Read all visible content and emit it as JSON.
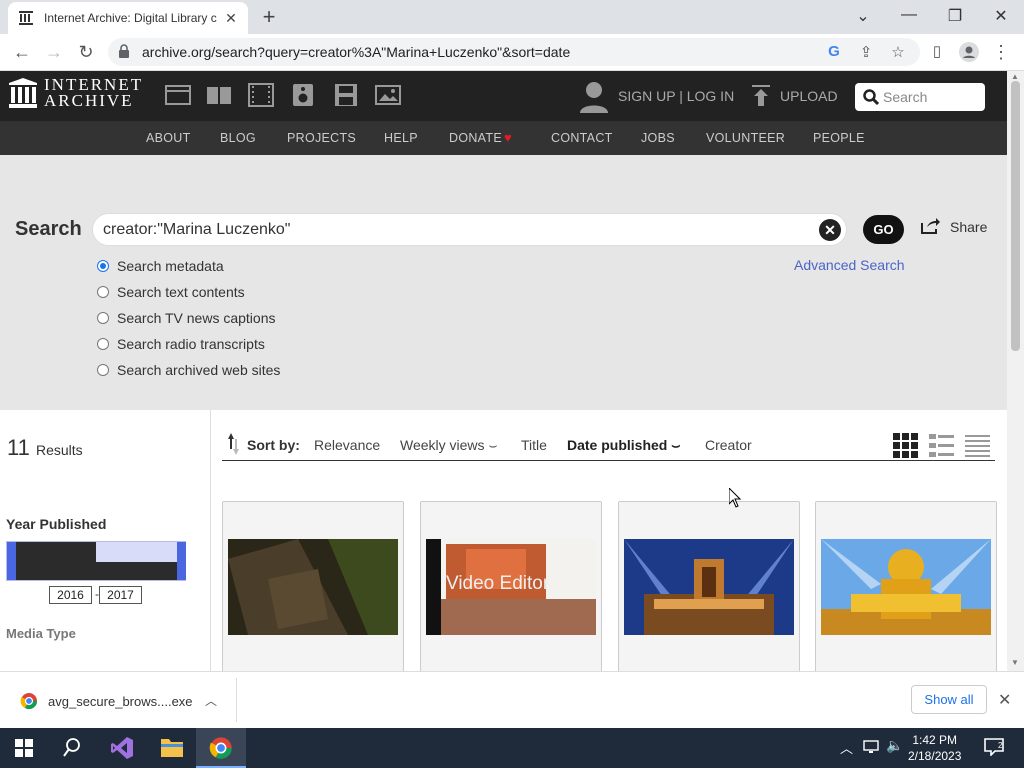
{
  "browser": {
    "tab_title": "Internet Archive: Digital Library c",
    "url": "archive.org/search?query=creator%3A\"Marina+Luczenko\"&sort=date"
  },
  "ia": {
    "logo_line1": "INTERNET",
    "logo_line2": "ARCHIVE",
    "signup": "SIGN UP | LOG IN",
    "upload": "UPLOAD",
    "search_placeholder": "Search",
    "nav": [
      "ABOUT",
      "BLOG",
      "PROJECTS",
      "HELP",
      "DONATE",
      "CONTACT",
      "JOBS",
      "VOLUNTEER",
      "PEOPLE"
    ]
  },
  "search": {
    "label": "Search",
    "query": "creator:\"Marina Luczenko\"",
    "go": "GO",
    "share": "Share",
    "advanced": "Advanced Search",
    "options": [
      "Search metadata",
      "Search text contents",
      "Search TV news captions",
      "Search radio transcripts",
      "Search archived web sites"
    ],
    "selected_option": 0
  },
  "results": {
    "count": "11",
    "count_label": "Results",
    "year_heading": "Year Published",
    "year_from": "2016",
    "year_to": "2017",
    "year_dash": "-",
    "media_type": "Media Type"
  },
  "sort": {
    "label": "Sort by:",
    "options": [
      "Relevance",
      "Weekly views",
      "Title",
      "Date published",
      "Creator"
    ],
    "active": "Date published"
  },
  "cards": [
    {
      "thumb": "dark-scene"
    },
    {
      "thumb": "video-editor-logo",
      "text": "Video Editor"
    },
    {
      "thumb": "orange-logo"
    },
    {
      "thumb": "golden-logo"
    }
  ],
  "download": {
    "filename": "avg_secure_brows....exe",
    "show_all": "Show all"
  },
  "taskbar": {
    "time": "1:42 PM",
    "date": "2/18/2023"
  }
}
